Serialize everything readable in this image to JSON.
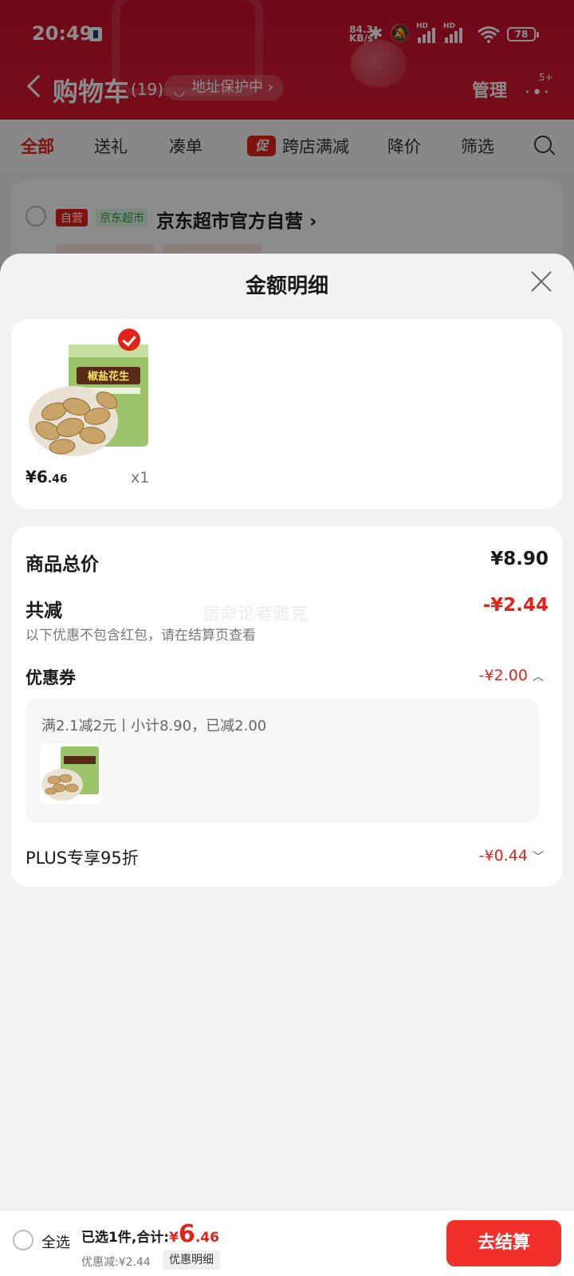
{
  "status_bar": {
    "time": "20:49",
    "net_speed_value": "84.3",
    "net_speed_unit": "KB/s",
    "battery": "78"
  },
  "header": {
    "title": "购物车",
    "count": "(19)",
    "address_protect": "地址保护中",
    "manage": "管理",
    "more_badge": "5+"
  },
  "tabs": [
    {
      "label": "全部",
      "active": true
    },
    {
      "label": "送礼"
    },
    {
      "label": "凑单"
    },
    {
      "label": "跨店满减",
      "badge": "促"
    },
    {
      "label": "降价"
    },
    {
      "label": "筛选"
    }
  ],
  "store": {
    "self_tag": "自营",
    "jd_tag": "京东超市",
    "name": "京东超市官方自营"
  },
  "sheet": {
    "title": "金额明细",
    "product": {
      "price_int": "¥6",
      "price_dec": ".46",
      "qty": "x1",
      "image": "salted-peanuts-bag"
    },
    "total_label": "商品总价",
    "total_value": "¥8.90",
    "reduce_label": "共减",
    "reduce_value": "-¥2.44",
    "reduce_note": "以下优惠不包含红包，请在结算页查看",
    "watermark": "宿命论者雅克",
    "coupon_label": "优惠券",
    "coupon_value": "-¥2.00",
    "coupon_detail": "满2.1减2元丨小计8.90，已减2.00",
    "plus_label": "PLUS专享95折",
    "plus_value": "-¥0.44"
  },
  "bottom_bar": {
    "select_all": "全选",
    "selected_text": "已选1件,合计:",
    "sum_yen": "¥",
    "sum_int": "6",
    "sum_dec": ".46",
    "discount": "优惠减:¥2.44",
    "discount_detail_btn": "优惠明细",
    "checkout": "去结算"
  },
  "colors": {
    "brand_red": "#e2231a",
    "header_red": "#c8102e",
    "checkout_red": "#f2302b"
  }
}
